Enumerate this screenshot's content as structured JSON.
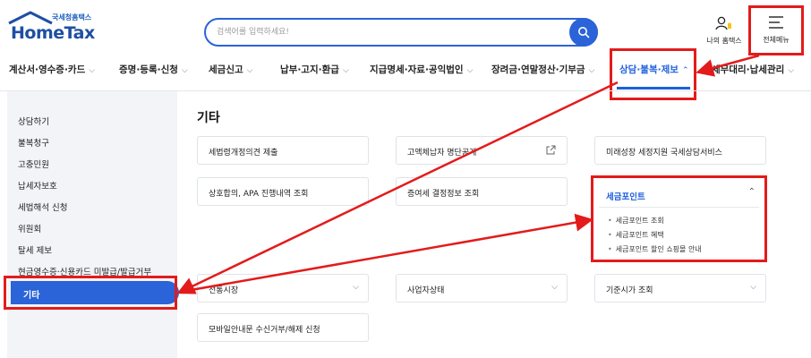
{
  "header": {
    "logo_small": "국세청홈택스",
    "logo_main": "HomeTax",
    "search_placeholder": "검색어를 입력하세요!",
    "my_home_label": "나의 홈택스",
    "all_menu_label": "전체메뉴"
  },
  "nav": {
    "items": [
      {
        "label": "계산서·영수증·카드"
      },
      {
        "label": "증명·등록·신청"
      },
      {
        "label": "세금신고"
      },
      {
        "label": "납부·고지·환급"
      },
      {
        "label": "지급명세·자료·공익법인"
      },
      {
        "label": "장려금·연말정산·기부금"
      },
      {
        "label": "상담·불복·제보",
        "active": true
      },
      {
        "label": "세무대리·납세관리"
      }
    ]
  },
  "sidebar": {
    "items": [
      {
        "label": "상담하기"
      },
      {
        "label": "불복청구"
      },
      {
        "label": "고충민원"
      },
      {
        "label": "납세자보호"
      },
      {
        "label": "세법해석 신청"
      },
      {
        "label": "위원회"
      },
      {
        "label": "탈세 제보"
      },
      {
        "label": "현금영수증·신용카드 미발급/발급거부"
      },
      {
        "label": "기타",
        "active": true
      }
    ]
  },
  "main": {
    "title": "기타",
    "cards": {
      "c1": "세법령개정의견 제출",
      "c2": "고액체납자 명단공개",
      "c3": "미래성장 세정지원 국세상담서비스",
      "c4": "상호합의, APA 진행내역 조회",
      "c5": "증여세 결정정보 조회",
      "c6": "전통시장",
      "c7": "사업자상태",
      "c8": "기준시가 조회",
      "c9": "모바일안내문 수신거부/해제 신청"
    },
    "point": {
      "title": "세금포인트",
      "subs": [
        "세금포인트 조회",
        "세금포인트 혜택",
        "세금포인트 할인 쇼핑몰 안내"
      ]
    }
  },
  "colors": {
    "accent": "#2b63d8",
    "highlight": "#e31b1b"
  }
}
